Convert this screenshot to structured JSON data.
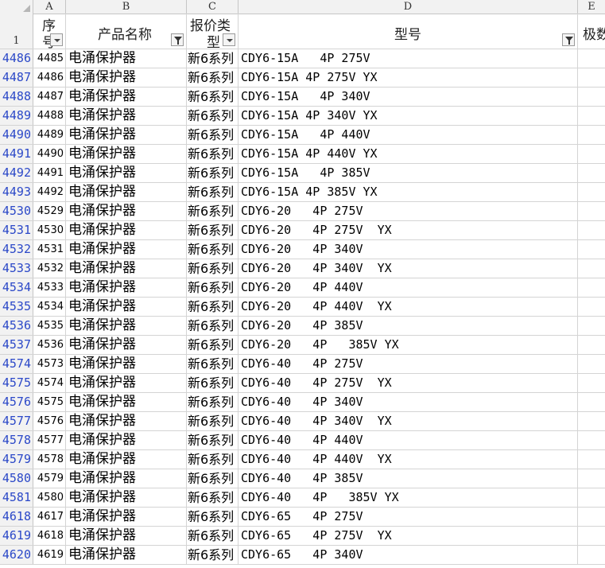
{
  "columns": [
    "A",
    "B",
    "C",
    "D",
    "E"
  ],
  "header": {
    "row_number": "1",
    "a_line1": "序",
    "a_line2": "号",
    "b": "产品名称",
    "c_line1": "报价类",
    "c_line2": "型",
    "d": "型号",
    "e": "极数"
  },
  "rows": [
    {
      "rn": "4486",
      "a": "4485",
      "b": "电涌保护器",
      "c": "新6系列",
      "d": "CDY6-15A   4P 275V"
    },
    {
      "rn": "4487",
      "a": "4486",
      "b": "电涌保护器",
      "c": "新6系列",
      "d": "CDY6-15A 4P 275V YX"
    },
    {
      "rn": "4488",
      "a": "4487",
      "b": "电涌保护器",
      "c": "新6系列",
      "d": "CDY6-15A   4P 340V"
    },
    {
      "rn": "4489",
      "a": "4488",
      "b": "电涌保护器",
      "c": "新6系列",
      "d": "CDY6-15A 4P 340V YX"
    },
    {
      "rn": "4490",
      "a": "4489",
      "b": "电涌保护器",
      "c": "新6系列",
      "d": "CDY6-15A   4P 440V"
    },
    {
      "rn": "4491",
      "a": "4490",
      "b": "电涌保护器",
      "c": "新6系列",
      "d": "CDY6-15A 4P 440V YX"
    },
    {
      "rn": "4492",
      "a": "4491",
      "b": "电涌保护器",
      "c": "新6系列",
      "d": "CDY6-15A   4P 385V"
    },
    {
      "rn": "4493",
      "a": "4492",
      "b": "电涌保护器",
      "c": "新6系列",
      "d": "CDY6-15A 4P 385V YX"
    },
    {
      "rn": "4530",
      "a": "4529",
      "b": "电涌保护器",
      "c": "新6系列",
      "d": "CDY6-20   4P 275V"
    },
    {
      "rn": "4531",
      "a": "4530",
      "b": "电涌保护器",
      "c": "新6系列",
      "d": "CDY6-20   4P 275V  YX"
    },
    {
      "rn": "4532",
      "a": "4531",
      "b": "电涌保护器",
      "c": "新6系列",
      "d": "CDY6-20   4P 340V"
    },
    {
      "rn": "4533",
      "a": "4532",
      "b": "电涌保护器",
      "c": "新6系列",
      "d": "CDY6-20   4P 340V  YX"
    },
    {
      "rn": "4534",
      "a": "4533",
      "b": "电涌保护器",
      "c": "新6系列",
      "d": "CDY6-20   4P 440V"
    },
    {
      "rn": "4535",
      "a": "4534",
      "b": "电涌保护器",
      "c": "新6系列",
      "d": "CDY6-20   4P 440V  YX"
    },
    {
      "rn": "4536",
      "a": "4535",
      "b": "电涌保护器",
      "c": "新6系列",
      "d": "CDY6-20   4P 385V"
    },
    {
      "rn": "4537",
      "a": "4536",
      "b": "电涌保护器",
      "c": "新6系列",
      "d": "CDY6-20   4P   385V YX"
    },
    {
      "rn": "4574",
      "a": "4573",
      "b": "电涌保护器",
      "c": "新6系列",
      "d": "CDY6-40   4P 275V"
    },
    {
      "rn": "4575",
      "a": "4574",
      "b": "电涌保护器",
      "c": "新6系列",
      "d": "CDY6-40   4P 275V  YX"
    },
    {
      "rn": "4576",
      "a": "4575",
      "b": "电涌保护器",
      "c": "新6系列",
      "d": "CDY6-40   4P 340V"
    },
    {
      "rn": "4577",
      "a": "4576",
      "b": "电涌保护器",
      "c": "新6系列",
      "d": "CDY6-40   4P 340V  YX"
    },
    {
      "rn": "4578",
      "a": "4577",
      "b": "电涌保护器",
      "c": "新6系列",
      "d": "CDY6-40   4P 440V"
    },
    {
      "rn": "4579",
      "a": "4578",
      "b": "电涌保护器",
      "c": "新6系列",
      "d": "CDY6-40   4P 440V  YX"
    },
    {
      "rn": "4580",
      "a": "4579",
      "b": "电涌保护器",
      "c": "新6系列",
      "d": "CDY6-40   4P 385V"
    },
    {
      "rn": "4581",
      "a": "4580",
      "b": "电涌保护器",
      "c": "新6系列",
      "d": "CDY6-40   4P   385V YX"
    },
    {
      "rn": "4618",
      "a": "4617",
      "b": "电涌保护器",
      "c": "新6系列",
      "d": "CDY6-65   4P 275V"
    },
    {
      "rn": "4619",
      "a": "4618",
      "b": "电涌保护器",
      "c": "新6系列",
      "d": "CDY6-65   4P 275V  YX"
    },
    {
      "rn": "4620",
      "a": "4619",
      "b": "电涌保护器",
      "c": "新6系列",
      "d": "CDY6-65   4P 340V"
    }
  ]
}
